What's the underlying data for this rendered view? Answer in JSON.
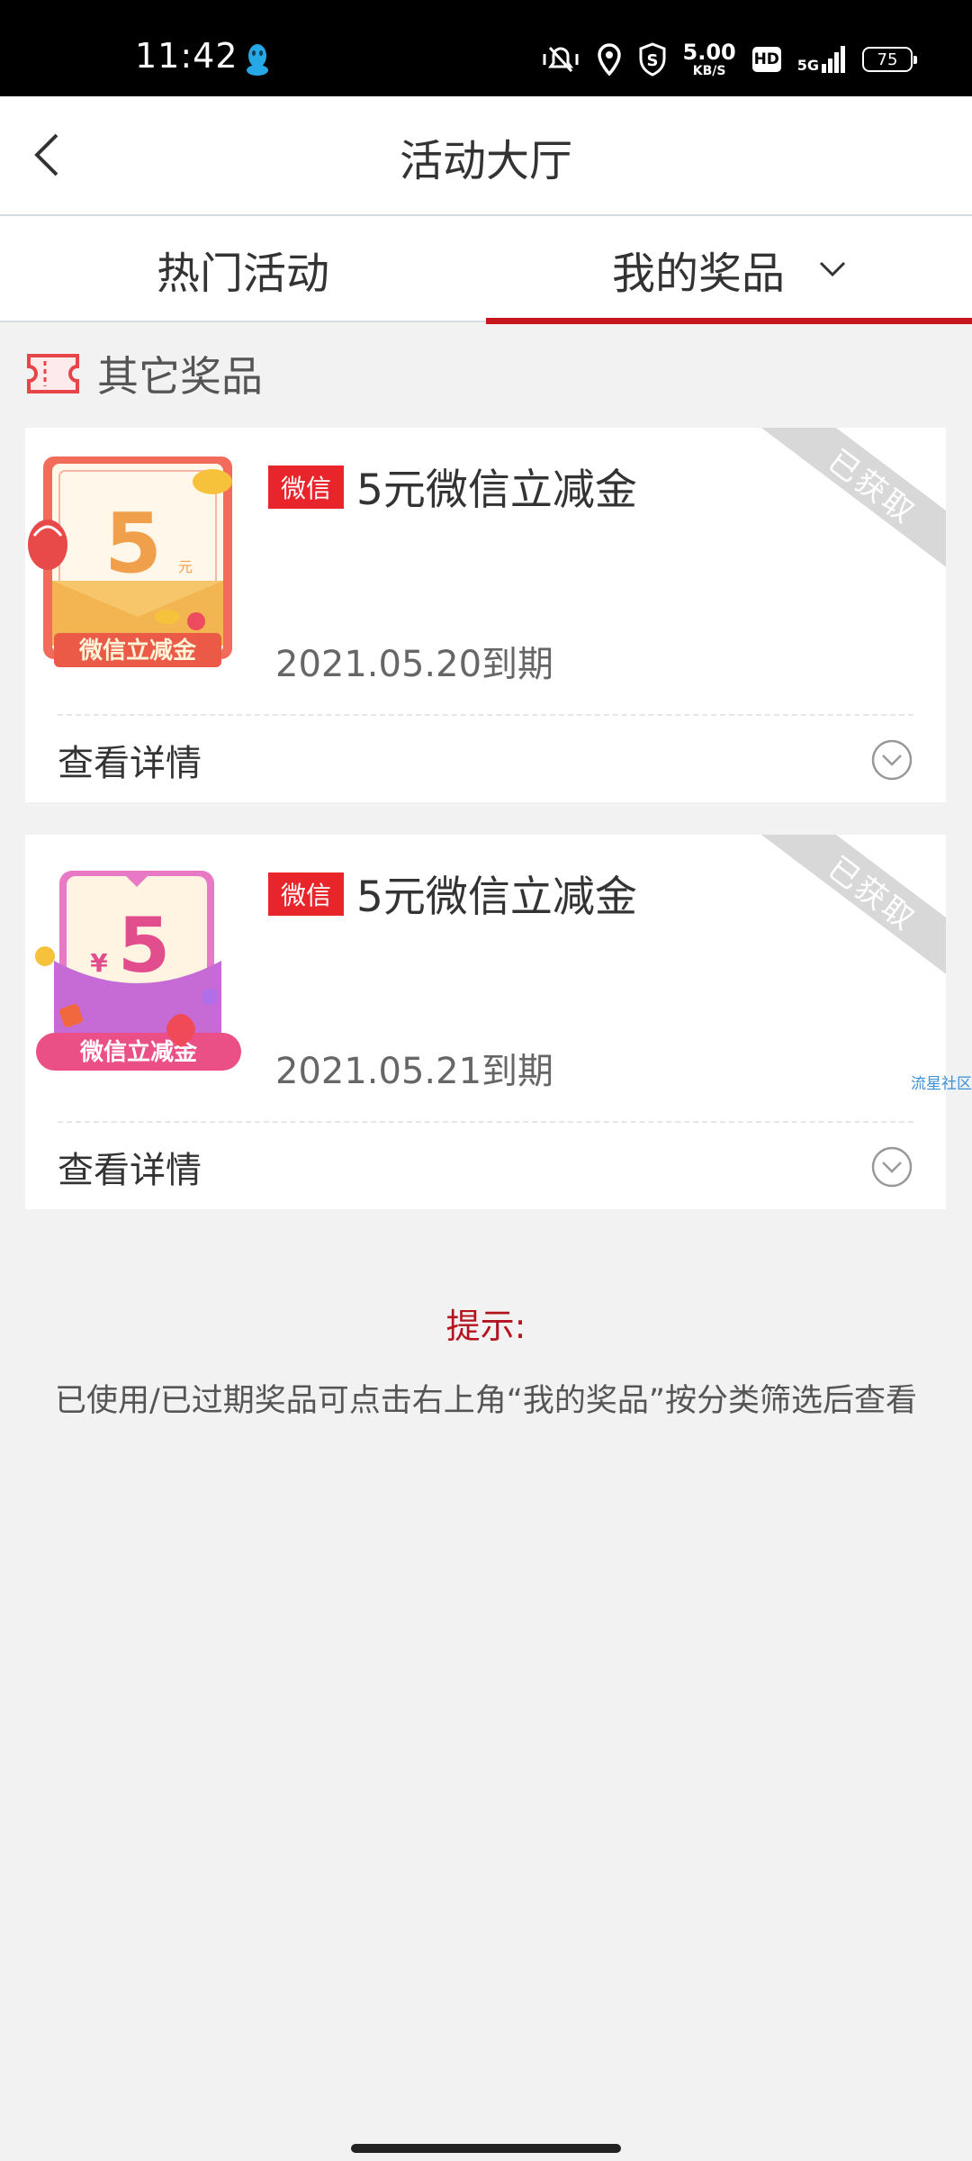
{
  "status_bar": {
    "time": "11:42",
    "net_speed_value": "5.00",
    "net_speed_unit": "KB/S",
    "hd_label": "HD",
    "network_label": "5G",
    "battery": "75",
    "icons": [
      "qq-icon",
      "mute-vibrate-icon",
      "location-icon",
      "shield-s-icon",
      "hd-icon",
      "signal-icon",
      "battery-icon"
    ]
  },
  "header": {
    "title": "活动大厅",
    "back_icon": "chevron-left-icon"
  },
  "tabs": [
    {
      "label": "热门活动",
      "active": false
    },
    {
      "label": "我的奖品",
      "active": true,
      "dropdown_icon": "chevron-down-icon"
    }
  ],
  "section": {
    "title": "其它奖品",
    "icon": "ticket-icon"
  },
  "prizes": [
    {
      "tag": "微信",
      "name": "5元微信立减金",
      "expire": "2021.05.20到期",
      "status": "已获取",
      "detail_label": "查看详情",
      "thumb_amount": "5",
      "thumb_unit": "元",
      "thumb_caption": "微信立减金"
    },
    {
      "tag": "微信",
      "name": "5元微信立减金",
      "expire": "2021.05.21到期",
      "status": "已获取",
      "detail_label": "查看详情",
      "thumb_amount": "5",
      "thumb_currency": "¥",
      "thumb_caption": "微信立减金"
    }
  ],
  "watermark": "流星社区",
  "tip": {
    "title": "提示:",
    "body": "已使用/已过期奖品可点击右上角“我的奖品”按分类筛选后查看"
  },
  "colors": {
    "accent": "#c8161e",
    "tag_red": "#e8252b",
    "background": "#f2f2f2",
    "ribbon_gray": "#d8d8d8"
  }
}
